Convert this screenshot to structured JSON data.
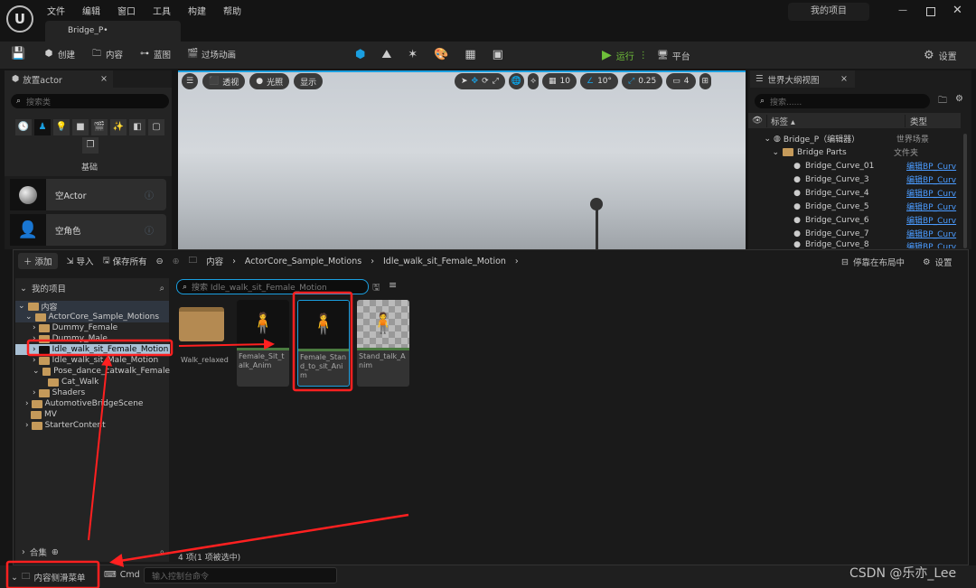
{
  "menu": [
    "文件",
    "编辑",
    "窗口",
    "工具",
    "构建",
    "帮助"
  ],
  "tab": "Bridge_P•",
  "project": "我的项目",
  "toolbar": {
    "create": "创建",
    "content": "内容",
    "blueprint": "蓝图",
    "cinematics": "过场动画",
    "play": "运行",
    "platform": "平台",
    "settings": "设置"
  },
  "place_actor": {
    "title": "放置actor",
    "search_placeholder": "搜索类",
    "category": "基础",
    "items": [
      {
        "label": "空Actor"
      },
      {
        "label": "空角色"
      }
    ]
  },
  "viewport": {
    "perspective": "透视",
    "lit": "光照",
    "show": "显示",
    "grid": "10",
    "angle": "10°",
    "scale": "0.25",
    "camera": "4"
  },
  "outliner": {
    "title": "世界大纲视图",
    "search_placeholder": "搜索......",
    "col_label": "标签",
    "col_type": "类型",
    "rows": [
      {
        "label": "Bridge_P（编辑器）",
        "type": "世界场景"
      },
      {
        "label": "Bridge Parts",
        "type": "文件夹"
      },
      {
        "label": "Bridge_Curve_01",
        "type": "编辑BP_Curv"
      },
      {
        "label": "Bridge_Curve_3",
        "type": "编辑BP_Curv"
      },
      {
        "label": "Bridge_Curve_4",
        "type": "编辑BP_Curv"
      },
      {
        "label": "Bridge_Curve_5",
        "type": "编辑BP_Curv"
      },
      {
        "label": "Bridge_Curve_6",
        "type": "编辑BP_Curv"
      },
      {
        "label": "Bridge_Curve_7",
        "type": "编辑BP_Curv"
      },
      {
        "label": "Bridge_Curve_8",
        "type": "编辑BP_Curv"
      }
    ]
  },
  "content_browser": {
    "add": "添加",
    "import": "导入",
    "save_all": "保存所有",
    "breadcrumb": [
      "内容",
      "ActorCore_Sample_Motions",
      "Idle_walk_sit_Female_Motion"
    ],
    "dock": "停靠在布局中",
    "settings": "设置",
    "tree_title": "我的项目",
    "tree": [
      {
        "label": "内容",
        "depth": 0
      },
      {
        "label": "ActorCore_Sample_Motions",
        "depth": 1
      },
      {
        "label": "Dummy_Female",
        "depth": 2
      },
      {
        "label": "Dummy_Male",
        "depth": 2
      },
      {
        "label": "Idle_walk_sit_Female_Motion",
        "depth": 2
      },
      {
        "label": "Idle_walk_sit_Male_Motion",
        "depth": 2
      },
      {
        "label": "Pose_dance_catwalk_Female",
        "depth": 2
      },
      {
        "label": "Cat_Walk",
        "depth": 3
      },
      {
        "label": "Shaders",
        "depth": 2
      },
      {
        "label": "AutomotiveBridgeScene",
        "depth": 1
      },
      {
        "label": "MV",
        "depth": 1
      },
      {
        "label": "StarterContent",
        "depth": 1
      }
    ],
    "collections": "合集",
    "search_placeholder": "搜索 Idle_walk_sit_Female_Motion",
    "assets": [
      {
        "label": "Walk_relaxed"
      },
      {
        "label": "Female_Sit_talk_Anim"
      },
      {
        "label": "Female_Stand_to_sit_Anim"
      },
      {
        "label": "Stand_talk_Anim"
      }
    ],
    "status": "4 项(1 项被选中)"
  },
  "bottom": {
    "drawer": "内容侧滑菜单",
    "cmd": "Cmd",
    "console_placeholder": "输入控制台命令"
  },
  "watermark": "CSDN @乐亦_Lee",
  "colors": {
    "accent": "#1a9fe0",
    "annotation": "#ff2020",
    "play": "#6fbf3a"
  }
}
